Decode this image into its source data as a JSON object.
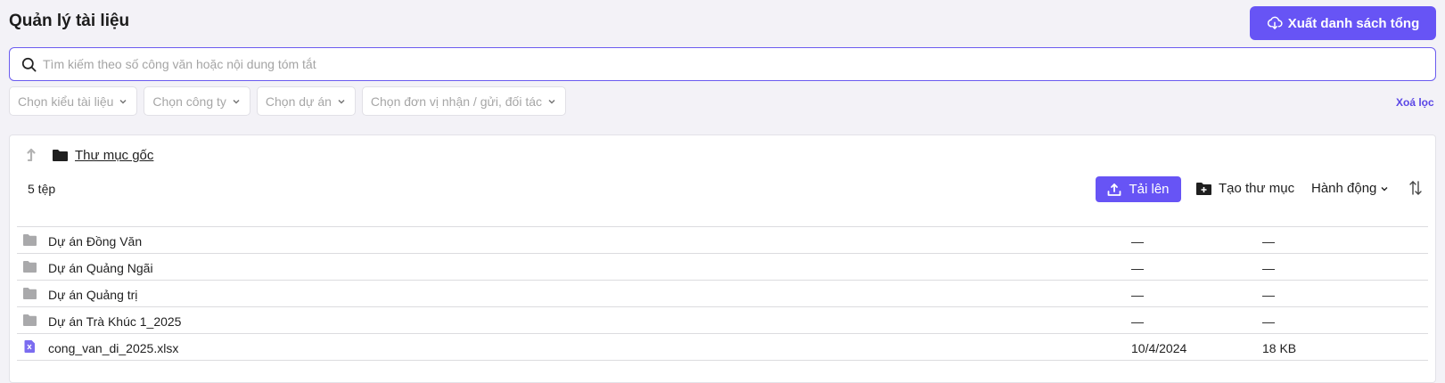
{
  "header": {
    "title": "Quản lý tài liệu",
    "export_label": "Xuất danh sách tổng",
    "accent": "#6754f5"
  },
  "search": {
    "value": "",
    "placeholder": "Tìm kiếm theo số công văn hoặc nội dung tóm tắt"
  },
  "filters": [
    {
      "label": "Chọn kiểu tài liệu"
    },
    {
      "label": "Chọn công ty"
    },
    {
      "label": "Chọn dự án"
    },
    {
      "label": "Chọn đơn vị nhận / gửi, đối tác"
    }
  ],
  "clear_filter": "Xoá lọc",
  "explorer": {
    "breadcrumb": "Thư mục gốc",
    "file_count": "5 tệp",
    "upload_label": "Tải lên",
    "new_folder_label": "Tạo thư mục",
    "actions_label": "Hành động",
    "rows": [
      {
        "type": "folder-icon",
        "name": "Dự án Đồng Văn",
        "date": "—",
        "size": "—"
      },
      {
        "type": "folder-icon",
        "name": "Dự án Quảng Ngãi",
        "date": "—",
        "size": "—"
      },
      {
        "type": "folder-icon",
        "name": "Dự án Quảng trị",
        "date": "—",
        "size": "—"
      },
      {
        "type": "folder-icon",
        "name": "Dự án Trà Khúc 1_2025",
        "date": "—",
        "size": "—"
      },
      {
        "type": "excel-file-icon",
        "name": "cong_van_di_2025.xlsx",
        "date": "10/4/2024",
        "size": "18 KB"
      }
    ]
  }
}
